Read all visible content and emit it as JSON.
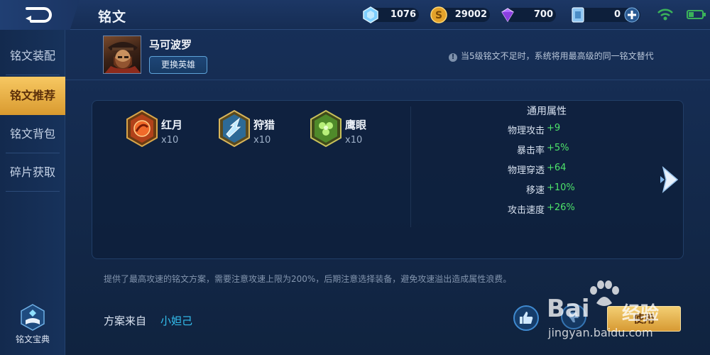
{
  "header": {
    "title": "铭文",
    "resources": [
      {
        "icon": "diamond-gem-icon",
        "value": "1076"
      },
      {
        "icon": "gold-coin-icon",
        "value": "29002"
      },
      {
        "icon": "purple-crystal-icon",
        "value": "700"
      },
      {
        "icon": "voucher-card-icon",
        "value": "0"
      }
    ]
  },
  "sidebar": {
    "items": [
      {
        "label": "铭文装配"
      },
      {
        "label": "铭文推荐"
      },
      {
        "label": "铭文背包"
      },
      {
        "label": "碎片获取"
      }
    ],
    "active_index": 1,
    "codex_label": "铭文宝典"
  },
  "hero": {
    "name": "马可波罗",
    "swap_label": "更换英雄",
    "notice": "当5级铭文不足时，系统将用最高级的同一铭文替代"
  },
  "runes": [
    {
      "name": "红月",
      "count": "x10",
      "color": "#c94a1c"
    },
    {
      "name": "狩猎",
      "count": "x10",
      "color": "#3c8fc2"
    },
    {
      "name": "鹰眼",
      "count": "x10",
      "color": "#6aa53a"
    }
  ],
  "attributes": {
    "title": "通用属性",
    "rows": [
      {
        "name": "物理攻击",
        "value": "+9"
      },
      {
        "name": "暴击率",
        "value": "+5%"
      },
      {
        "name": "物理穿透",
        "value": "+64"
      },
      {
        "name": "移速",
        "value": "+10%"
      },
      {
        "name": "攻击速度",
        "value": "+26%"
      }
    ]
  },
  "description": "提供了最高攻速的铭文方案，需要注意攻速上限为200%，后期注意选择装备，避免攻速溢出造成属性浪费。",
  "source": {
    "label": "方案来自",
    "author": "小妲己"
  },
  "actions": {
    "use_label": "使用"
  },
  "watermark": {
    "brand": "Bai",
    "brand_cn": "经验",
    "url": "jingyan.baidu.com"
  }
}
